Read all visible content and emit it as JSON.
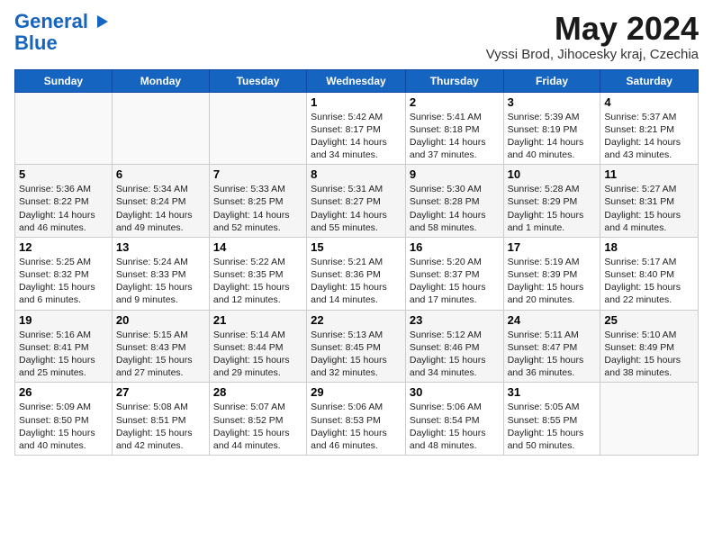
{
  "header": {
    "logo_line1": "General",
    "logo_line2": "Blue",
    "month": "May 2024",
    "location": "Vyssi Brod, Jihocesky kraj, Czechia"
  },
  "weekdays": [
    "Sunday",
    "Monday",
    "Tuesday",
    "Wednesday",
    "Thursday",
    "Friday",
    "Saturday"
  ],
  "weeks": [
    [
      {
        "day": "",
        "info": ""
      },
      {
        "day": "",
        "info": ""
      },
      {
        "day": "",
        "info": ""
      },
      {
        "day": "1",
        "info": "Sunrise: 5:42 AM\nSunset: 8:17 PM\nDaylight: 14 hours\nand 34 minutes."
      },
      {
        "day": "2",
        "info": "Sunrise: 5:41 AM\nSunset: 8:18 PM\nDaylight: 14 hours\nand 37 minutes."
      },
      {
        "day": "3",
        "info": "Sunrise: 5:39 AM\nSunset: 8:19 PM\nDaylight: 14 hours\nand 40 minutes."
      },
      {
        "day": "4",
        "info": "Sunrise: 5:37 AM\nSunset: 8:21 PM\nDaylight: 14 hours\nand 43 minutes."
      }
    ],
    [
      {
        "day": "5",
        "info": "Sunrise: 5:36 AM\nSunset: 8:22 PM\nDaylight: 14 hours\nand 46 minutes."
      },
      {
        "day": "6",
        "info": "Sunrise: 5:34 AM\nSunset: 8:24 PM\nDaylight: 14 hours\nand 49 minutes."
      },
      {
        "day": "7",
        "info": "Sunrise: 5:33 AM\nSunset: 8:25 PM\nDaylight: 14 hours\nand 52 minutes."
      },
      {
        "day": "8",
        "info": "Sunrise: 5:31 AM\nSunset: 8:27 PM\nDaylight: 14 hours\nand 55 minutes."
      },
      {
        "day": "9",
        "info": "Sunrise: 5:30 AM\nSunset: 8:28 PM\nDaylight: 14 hours\nand 58 minutes."
      },
      {
        "day": "10",
        "info": "Sunrise: 5:28 AM\nSunset: 8:29 PM\nDaylight: 15 hours\nand 1 minute."
      },
      {
        "day": "11",
        "info": "Sunrise: 5:27 AM\nSunset: 8:31 PM\nDaylight: 15 hours\nand 4 minutes."
      }
    ],
    [
      {
        "day": "12",
        "info": "Sunrise: 5:25 AM\nSunset: 8:32 PM\nDaylight: 15 hours\nand 6 minutes."
      },
      {
        "day": "13",
        "info": "Sunrise: 5:24 AM\nSunset: 8:33 PM\nDaylight: 15 hours\nand 9 minutes."
      },
      {
        "day": "14",
        "info": "Sunrise: 5:22 AM\nSunset: 8:35 PM\nDaylight: 15 hours\nand 12 minutes."
      },
      {
        "day": "15",
        "info": "Sunrise: 5:21 AM\nSunset: 8:36 PM\nDaylight: 15 hours\nand 14 minutes."
      },
      {
        "day": "16",
        "info": "Sunrise: 5:20 AM\nSunset: 8:37 PM\nDaylight: 15 hours\nand 17 minutes."
      },
      {
        "day": "17",
        "info": "Sunrise: 5:19 AM\nSunset: 8:39 PM\nDaylight: 15 hours\nand 20 minutes."
      },
      {
        "day": "18",
        "info": "Sunrise: 5:17 AM\nSunset: 8:40 PM\nDaylight: 15 hours\nand 22 minutes."
      }
    ],
    [
      {
        "day": "19",
        "info": "Sunrise: 5:16 AM\nSunset: 8:41 PM\nDaylight: 15 hours\nand 25 minutes."
      },
      {
        "day": "20",
        "info": "Sunrise: 5:15 AM\nSunset: 8:43 PM\nDaylight: 15 hours\nand 27 minutes."
      },
      {
        "day": "21",
        "info": "Sunrise: 5:14 AM\nSunset: 8:44 PM\nDaylight: 15 hours\nand 29 minutes."
      },
      {
        "day": "22",
        "info": "Sunrise: 5:13 AM\nSunset: 8:45 PM\nDaylight: 15 hours\nand 32 minutes."
      },
      {
        "day": "23",
        "info": "Sunrise: 5:12 AM\nSunset: 8:46 PM\nDaylight: 15 hours\nand 34 minutes."
      },
      {
        "day": "24",
        "info": "Sunrise: 5:11 AM\nSunset: 8:47 PM\nDaylight: 15 hours\nand 36 minutes."
      },
      {
        "day": "25",
        "info": "Sunrise: 5:10 AM\nSunset: 8:49 PM\nDaylight: 15 hours\nand 38 minutes."
      }
    ],
    [
      {
        "day": "26",
        "info": "Sunrise: 5:09 AM\nSunset: 8:50 PM\nDaylight: 15 hours\nand 40 minutes."
      },
      {
        "day": "27",
        "info": "Sunrise: 5:08 AM\nSunset: 8:51 PM\nDaylight: 15 hours\nand 42 minutes."
      },
      {
        "day": "28",
        "info": "Sunrise: 5:07 AM\nSunset: 8:52 PM\nDaylight: 15 hours\nand 44 minutes."
      },
      {
        "day": "29",
        "info": "Sunrise: 5:06 AM\nSunset: 8:53 PM\nDaylight: 15 hours\nand 46 minutes."
      },
      {
        "day": "30",
        "info": "Sunrise: 5:06 AM\nSunset: 8:54 PM\nDaylight: 15 hours\nand 48 minutes."
      },
      {
        "day": "31",
        "info": "Sunrise: 5:05 AM\nSunset: 8:55 PM\nDaylight: 15 hours\nand 50 minutes."
      },
      {
        "day": "",
        "info": ""
      }
    ]
  ]
}
